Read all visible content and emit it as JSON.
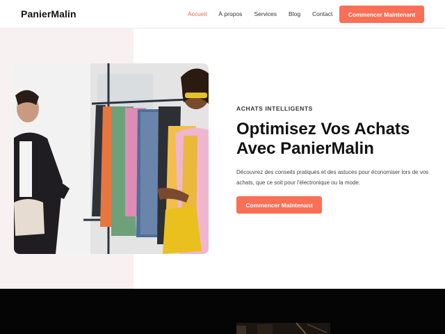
{
  "header": {
    "brand": "PanierMalin",
    "nav": [
      {
        "label": "Accueil",
        "active": true
      },
      {
        "label": "À propos",
        "active": false
      },
      {
        "label": "Services",
        "active": false
      },
      {
        "label": "Blog",
        "active": false
      },
      {
        "label": "Contact",
        "active": false
      }
    ],
    "cta_label": "Commencer Maintenant"
  },
  "hero": {
    "kicker": "ACHATS INTELLIGENTS",
    "headline_line1": "Optimisez Vos Achats",
    "headline_line2": "Avec PanierMalin",
    "description": "Découvrez des conseils pratiques et des astuces pour économiser lors de vos achats, que ce soit pour l'électronique ou la mode.",
    "cta_label": "Commencer Maintenant",
    "image_icon": "shopping-clothes-rack-photo"
  },
  "colors": {
    "accent": "#fb6f56",
    "nav_active": "#e56a4f",
    "hero_bg": "#f7f1f1",
    "dark_band": "#050505"
  }
}
